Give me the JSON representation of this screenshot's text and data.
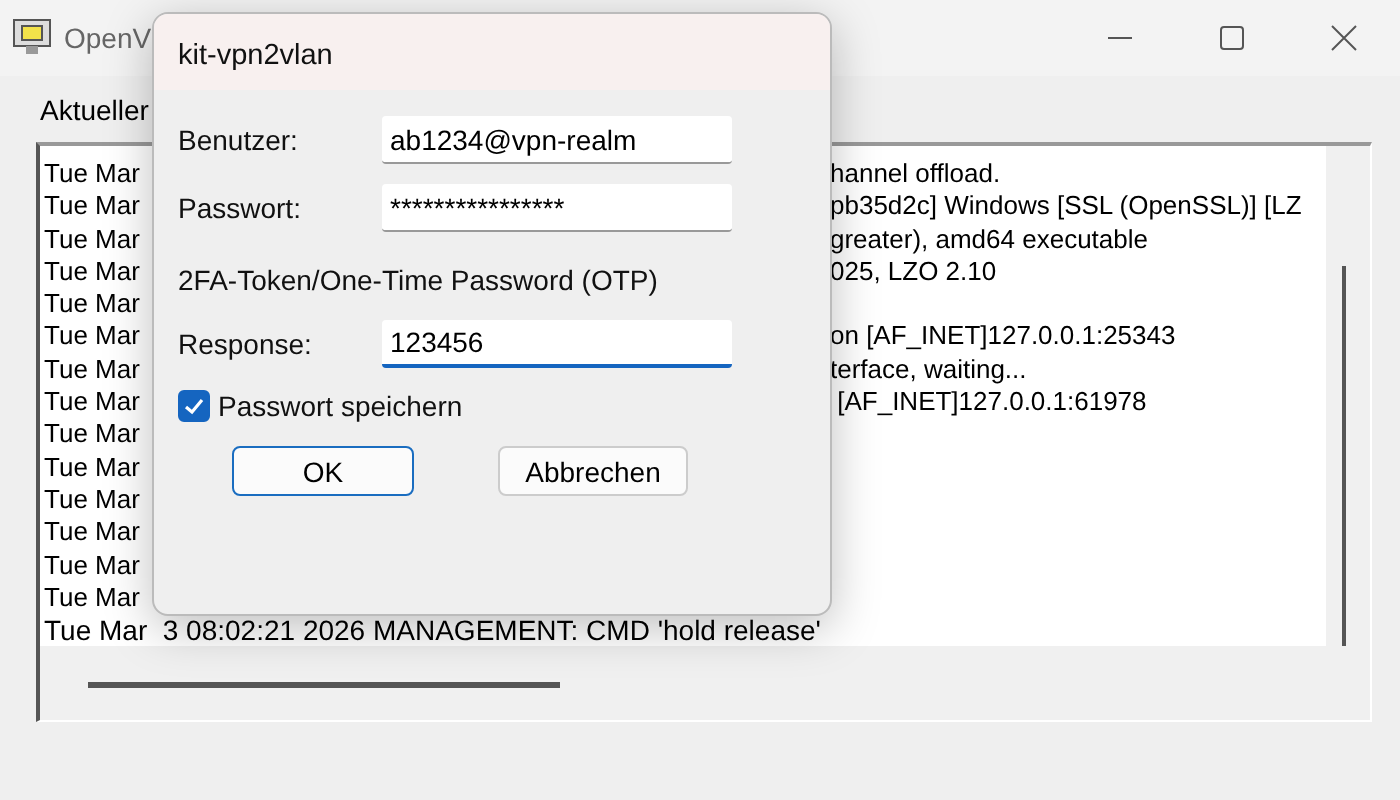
{
  "window": {
    "title": "OpenV"
  },
  "status_label": "Aktueller",
  "log": [
    {
      "kind": "split",
      "left": "Tue Mar",
      "right": "hannel offload."
    },
    {
      "kind": "split",
      "left": "Tue Mar",
      "right": "pb35d2c] Windows [SSL (OpenSSL)] [LZ"
    },
    {
      "kind": "split",
      "left": "Tue Mar",
      "right": "greater), amd64 executable"
    },
    {
      "kind": "split",
      "left": "Tue Mar",
      "right": "025, LZO 2.10"
    },
    {
      "kind": "split",
      "left": "Tue Mar"
    },
    {
      "kind": "split",
      "left": "Tue Mar",
      "right": "on [AF_INET]127.0.0.1:25343"
    },
    {
      "kind": "split",
      "left": "Tue Mar",
      "right": "terface, waiting..."
    },
    {
      "kind": "split",
      "left": "Tue Mar",
      "right": " [AF_INET]127.0.0.1:61978"
    },
    {
      "kind": "split",
      "left": "Tue Mar"
    },
    {
      "kind": "split",
      "left": "Tue Mar"
    },
    {
      "kind": "split",
      "left": "Tue Mar"
    },
    {
      "kind": "split",
      "left": "Tue Mar"
    },
    {
      "kind": "split",
      "left": "Tue Mar"
    },
    {
      "kind": "split",
      "left": "Tue Mar"
    },
    {
      "kind": "full",
      "text": "Tue Mar  3 08:02:21 2026 MANAGEMENT: CMD 'hold release'"
    }
  ],
  "dialog": {
    "title": "kit-vpn2vlan",
    "credentials": [
      {
        "label": "Benutzer:",
        "value": "ab1234@vpn-realm",
        "focused": false
      },
      {
        "label": "Passwort:",
        "value": "****************",
        "focused": false
      }
    ],
    "otp": {
      "heading": "2FA-Token/One-Time Password (OTP)",
      "field": {
        "label": "Response:",
        "value": "123456",
        "focused": true
      }
    },
    "save_password": {
      "label": "Passwort speichern",
      "checked": true
    },
    "buttons": [
      {
        "label": "OK",
        "default": true
      },
      {
        "label": "Abbrechen",
        "default": false
      }
    ]
  }
}
